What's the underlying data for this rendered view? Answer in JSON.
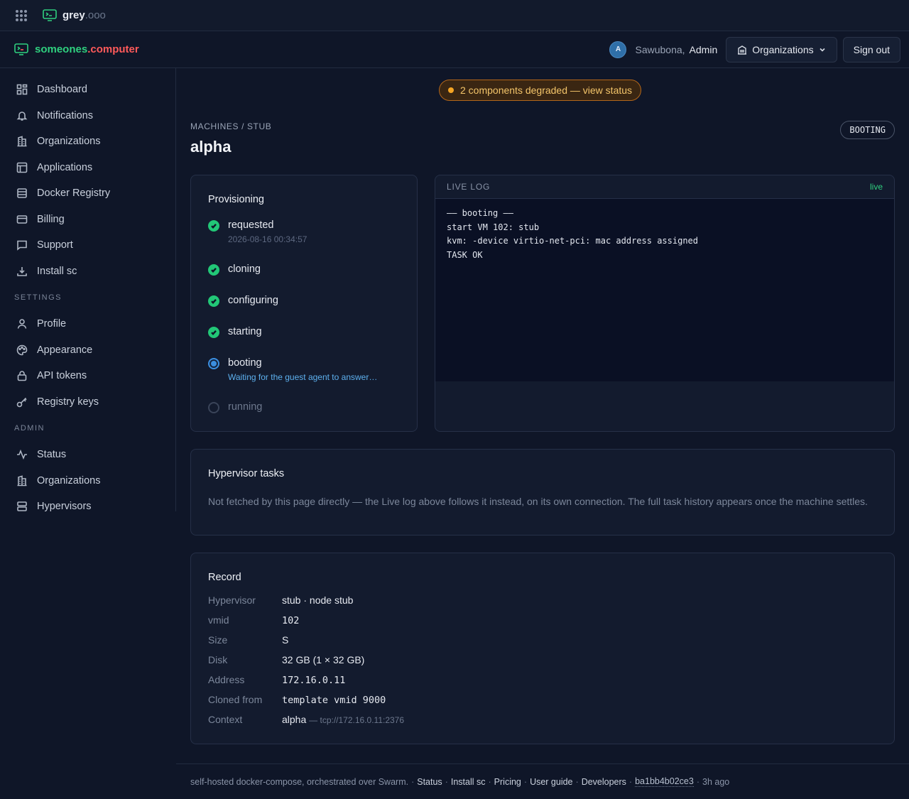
{
  "topbar": {
    "brand_name": "grey",
    "brand_tld": ".ooo",
    "icon": "apps-grid-icon"
  },
  "header": {
    "brand_part1": "someones",
    "brand_part2": ".computer",
    "avatar_initial": "A",
    "greeting": "Sawubona,",
    "user_name": "Admin",
    "org_button": "Organizations",
    "signout_button": "Sign out"
  },
  "sidebar": {
    "items": [
      {
        "label": "Dashboard",
        "icon": "dashboard-icon"
      },
      {
        "label": "Notifications",
        "icon": "bell-icon"
      },
      {
        "label": "Organizations",
        "icon": "building-icon"
      },
      {
        "label": "Applications",
        "icon": "layout-icon"
      },
      {
        "label": "Docker Registry",
        "icon": "database-icon"
      },
      {
        "label": "Billing",
        "icon": "credit-card-icon"
      },
      {
        "label": "Support",
        "icon": "message-icon"
      },
      {
        "label": "Install sc",
        "icon": "download-icon"
      }
    ],
    "settings_heading": "SETTINGS",
    "settings_items": [
      {
        "label": "Profile",
        "icon": "user-icon"
      },
      {
        "label": "Appearance",
        "icon": "palette-icon"
      },
      {
        "label": "API tokens",
        "icon": "lock-icon"
      },
      {
        "label": "Registry keys",
        "icon": "key-icon"
      }
    ],
    "admin_heading": "ADMIN",
    "admin_items": [
      {
        "label": "Status",
        "icon": "activity-icon"
      },
      {
        "label": "Organizations",
        "icon": "building-icon"
      },
      {
        "label": "Hypervisors",
        "icon": "server-icon"
      }
    ]
  },
  "banner": {
    "text": "2 components degraded — view status",
    "color": "#f5a524"
  },
  "page": {
    "breadcrumb": "MACHINES / STUB",
    "title": "alpha",
    "state": "BOOTING"
  },
  "provisioning": {
    "heading": "Provisioning",
    "steps": [
      {
        "label": "requested",
        "sub": "2026-08-16 00:34:57",
        "state": "done"
      },
      {
        "label": "cloning",
        "state": "done"
      },
      {
        "label": "configuring",
        "state": "done"
      },
      {
        "label": "starting",
        "state": "done"
      },
      {
        "label": "booting",
        "sub": "Waiting for the guest agent to answer…",
        "state": "active"
      },
      {
        "label": "running",
        "state": "pending"
      }
    ]
  },
  "live_log": {
    "heading": "LIVE LOG",
    "live_label": "live",
    "lines": [
      "—— booting ——",
      "start VM 102: stub",
      "kvm: -device virtio-net-pci: mac address assigned",
      "TASK OK"
    ]
  },
  "hypervisor_tasks": {
    "heading": "Hypervisor tasks",
    "text": "Not fetched by this page directly — the Live log above follows it instead, on its own connection. The full task history appears once the machine settles."
  },
  "record": {
    "heading": "Record",
    "rows": [
      {
        "key": "Hypervisor",
        "value": "stub · node stub"
      },
      {
        "key": "vmid",
        "value": "102"
      },
      {
        "key": "Size",
        "value": "S"
      },
      {
        "key": "Disk",
        "value": "32 GB (1 × 32 GB)"
      },
      {
        "key": "Address",
        "value": "172.16.0.11"
      },
      {
        "key": "Cloned from",
        "value": "template vmid 9000"
      },
      {
        "key": "Context",
        "value": "alpha",
        "extra": "— tcp://172.16.0.11:2376"
      }
    ]
  },
  "footer": {
    "text": "self-hosted docker-compose, orchestrated over Swarm.",
    "links": [
      "Status",
      "Install sc",
      "Pricing",
      "User guide",
      "Developers"
    ],
    "commit": "ba1bb4b02ce3",
    "age": "3h ago"
  },
  "colors": {
    "accent_green": "#2fd07f",
    "accent_red": "#ff5a5a",
    "active_blue": "#3b8fe0"
  }
}
